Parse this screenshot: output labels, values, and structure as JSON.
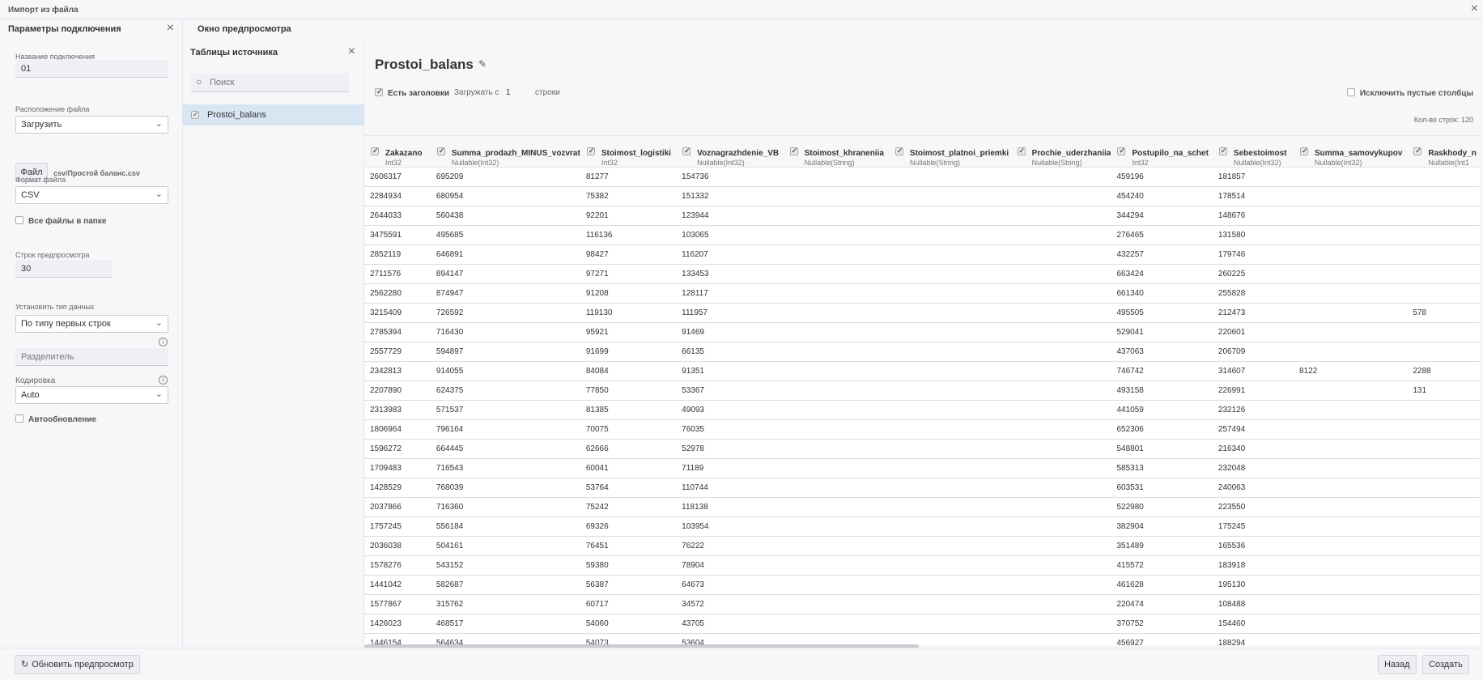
{
  "window": {
    "title": "Импорт из файла"
  },
  "left": {
    "heading": "Параметры подключения",
    "conn_name_label": "Название подключения",
    "conn_name_value": "01",
    "location_label": "Расположение файла",
    "location_value": "Загрузить",
    "file_button": "Файл",
    "file_name": "csv/Простой баланс.csv",
    "format_label": "Формат файла",
    "format_value": "CSV",
    "all_files_label": "Все файлы в папке",
    "preview_rows_label": "Строк предпросмотра",
    "preview_rows_value": "30",
    "datatype_label": "Установить тип данных",
    "datatype_value": "По типу первых строк",
    "separator_placeholder": "Разделитель",
    "encoding_label": "Кодировка",
    "encoding_value": "Auto",
    "autoupdate_label": "Автообновление"
  },
  "preview": {
    "heading": "Окно предпросмотра"
  },
  "source": {
    "heading": "Таблицы источника",
    "search_placeholder": "Поиск",
    "items": [
      "Prostoi_balans"
    ]
  },
  "main": {
    "table_title": "Prostoi_balans",
    "headers_label": "Есть заголовки",
    "load_from_label": "Загружать с",
    "load_from_value": "1",
    "rows_suffix": "строки",
    "exclude_empty_label": "Исключить пустые столбцы",
    "row_count": "Кол-во строк: 120",
    "columns": [
      {
        "name": "Zakazano",
        "type": "Int32"
      },
      {
        "name": "Summa_prodazh_MINUS_vozvrat",
        "type": "Nullable(Int32)"
      },
      {
        "name": "Stoimost_logistiki",
        "type": "Int32"
      },
      {
        "name": "Voznagrazhdenie_VB",
        "type": "Nullable(Int32)"
      },
      {
        "name": "Stoimost_khraneniia",
        "type": "Nullable(String)"
      },
      {
        "name": "Stoimost_platnoi_priemki",
        "type": "Nullable(String)"
      },
      {
        "name": "Prochie_uderzhaniia",
        "type": "Nullable(String)"
      },
      {
        "name": "Postupilo_na_schet",
        "type": "Int32"
      },
      {
        "name": "Sebestoimost",
        "type": "Nullable(Int32)"
      },
      {
        "name": "Summa_samovykupov",
        "type": "Nullable(Int32)"
      },
      {
        "name": "Raskhody_n",
        "type": "Nullable(Int1"
      }
    ],
    "rows": [
      [
        "2606317",
        "695209",
        "81277",
        "154736",
        "",
        "",
        "",
        "459196",
        "181857",
        "",
        ""
      ],
      [
        "2284934",
        "680954",
        "75382",
        "151332",
        "",
        "",
        "",
        "454240",
        "178514",
        "",
        ""
      ],
      [
        "2644033",
        "560438",
        "92201",
        "123944",
        "",
        "",
        "",
        "344294",
        "148676",
        "",
        ""
      ],
      [
        "3475591",
        "495685",
        "116136",
        "103065",
        "",
        "",
        "",
        "276465",
        "131580",
        "",
        ""
      ],
      [
        "2852119",
        "646891",
        "98427",
        "116207",
        "",
        "",
        "",
        "432257",
        "179746",
        "",
        ""
      ],
      [
        "2711576",
        "894147",
        "97271",
        "133453",
        "",
        "",
        "",
        "663424",
        "260225",
        "",
        ""
      ],
      [
        "2562280",
        "874947",
        "91208",
        "128117",
        "",
        "",
        "",
        "661340",
        "255828",
        "",
        ""
      ],
      [
        "3215409",
        "726592",
        "119130",
        "111957",
        "",
        "",
        "",
        "495505",
        "212473",
        "",
        "578"
      ],
      [
        "2785394",
        "716430",
        "95921",
        "91469",
        "",
        "",
        "",
        "529041",
        "220601",
        "",
        ""
      ],
      [
        "2557729",
        "594897",
        "91699",
        "66135",
        "",
        "",
        "",
        "437063",
        "206709",
        "",
        ""
      ],
      [
        "2342813",
        "914055",
        "84084",
        "91351",
        "",
        "",
        "",
        "746742",
        "314607",
        "8122",
        "2288"
      ],
      [
        "2207890",
        "624375",
        "77850",
        "53367",
        "",
        "",
        "",
        "493158",
        "226991",
        "",
        "131"
      ],
      [
        "2313983",
        "571537",
        "81385",
        "49093",
        "",
        "",
        "",
        "441059",
        "232126",
        "",
        ""
      ],
      [
        "1806964",
        "796164",
        "70075",
        "76035",
        "",
        "",
        "",
        "652306",
        "257494",
        "",
        ""
      ],
      [
        "1596272",
        "664445",
        "62666",
        "52978",
        "",
        "",
        "",
        "548801",
        "216340",
        "",
        ""
      ],
      [
        "1709483",
        "716543",
        "60041",
        "71189",
        "",
        "",
        "",
        "585313",
        "232048",
        "",
        ""
      ],
      [
        "1428529",
        "768039",
        "53764",
        "110744",
        "",
        "",
        "",
        "603531",
        "240063",
        "",
        ""
      ],
      [
        "2037866",
        "716360",
        "75242",
        "118138",
        "",
        "",
        "",
        "522980",
        "223550",
        "",
        ""
      ],
      [
        "1757245",
        "556184",
        "69326",
        "103954",
        "",
        "",
        "",
        "382904",
        "175245",
        "",
        ""
      ],
      [
        "2036038",
        "504161",
        "76451",
        "76222",
        "",
        "",
        "",
        "351489",
        "165536",
        "",
        ""
      ],
      [
        "1578276",
        "543152",
        "59380",
        "78904",
        "",
        "",
        "",
        "415572",
        "183918",
        "",
        ""
      ],
      [
        "1441042",
        "582687",
        "56387",
        "64673",
        "",
        "",
        "",
        "461628",
        "195130",
        "",
        ""
      ],
      [
        "1577867",
        "315762",
        "60717",
        "34572",
        "",
        "",
        "",
        "220474",
        "108488",
        "",
        ""
      ],
      [
        "1426023",
        "468517",
        "54060",
        "43705",
        "",
        "",
        "",
        "370752",
        "154460",
        "",
        ""
      ],
      [
        "1446154",
        "564634",
        "54073",
        "53604",
        "",
        "",
        "",
        "456927",
        "188294",
        "",
        ""
      ]
    ]
  },
  "footer": {
    "refresh_label": "Обновить предпросмотр",
    "back_label": "Назад",
    "create_label": "Создать"
  }
}
